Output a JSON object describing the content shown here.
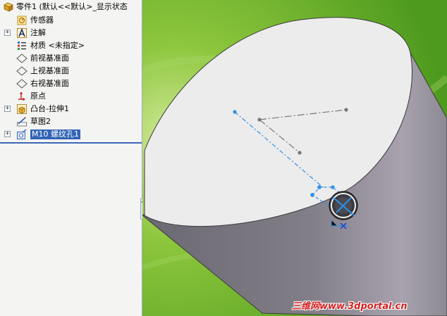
{
  "feature_tree": {
    "root": {
      "label": "零件1  (默认<<默认>_显示状态",
      "icon": "part-icon"
    },
    "items": [
      {
        "label": "传感器",
        "icon": "sensor-icon",
        "expandable": false
      },
      {
        "label": "注解",
        "icon": "annotation-icon",
        "expandable": true
      },
      {
        "label": "材质 <未指定>",
        "icon": "material-icon",
        "expandable": false
      },
      {
        "label": "前视基准面",
        "icon": "plane-icon",
        "expandable": false
      },
      {
        "label": "上视基准面",
        "icon": "plane-icon",
        "expandable": false
      },
      {
        "label": "右视基准面",
        "icon": "plane-icon",
        "expandable": false
      },
      {
        "label": "原点",
        "icon": "origin-icon",
        "expandable": false
      },
      {
        "label": "凸台-拉伸1",
        "icon": "extrude-icon",
        "expandable": true
      },
      {
        "label": "草图2",
        "icon": "sketch-icon",
        "expandable": false
      },
      {
        "label": "M10 螺纹孔1",
        "icon": "hole-wizard-icon",
        "expandable": true,
        "selected": true
      }
    ],
    "expand_glyph": "+",
    "collapse_glyph": "‹‹‹"
  },
  "viewport": {
    "model": "cylinder",
    "colors": {
      "background": "#7db83a",
      "top_face": "#ececec",
      "side_face": "#7e7a82",
      "sketch": "#2d8fe6"
    }
  },
  "watermark": {
    "text": "三维网www.3dportal.cn",
    "color": "#d42020"
  }
}
